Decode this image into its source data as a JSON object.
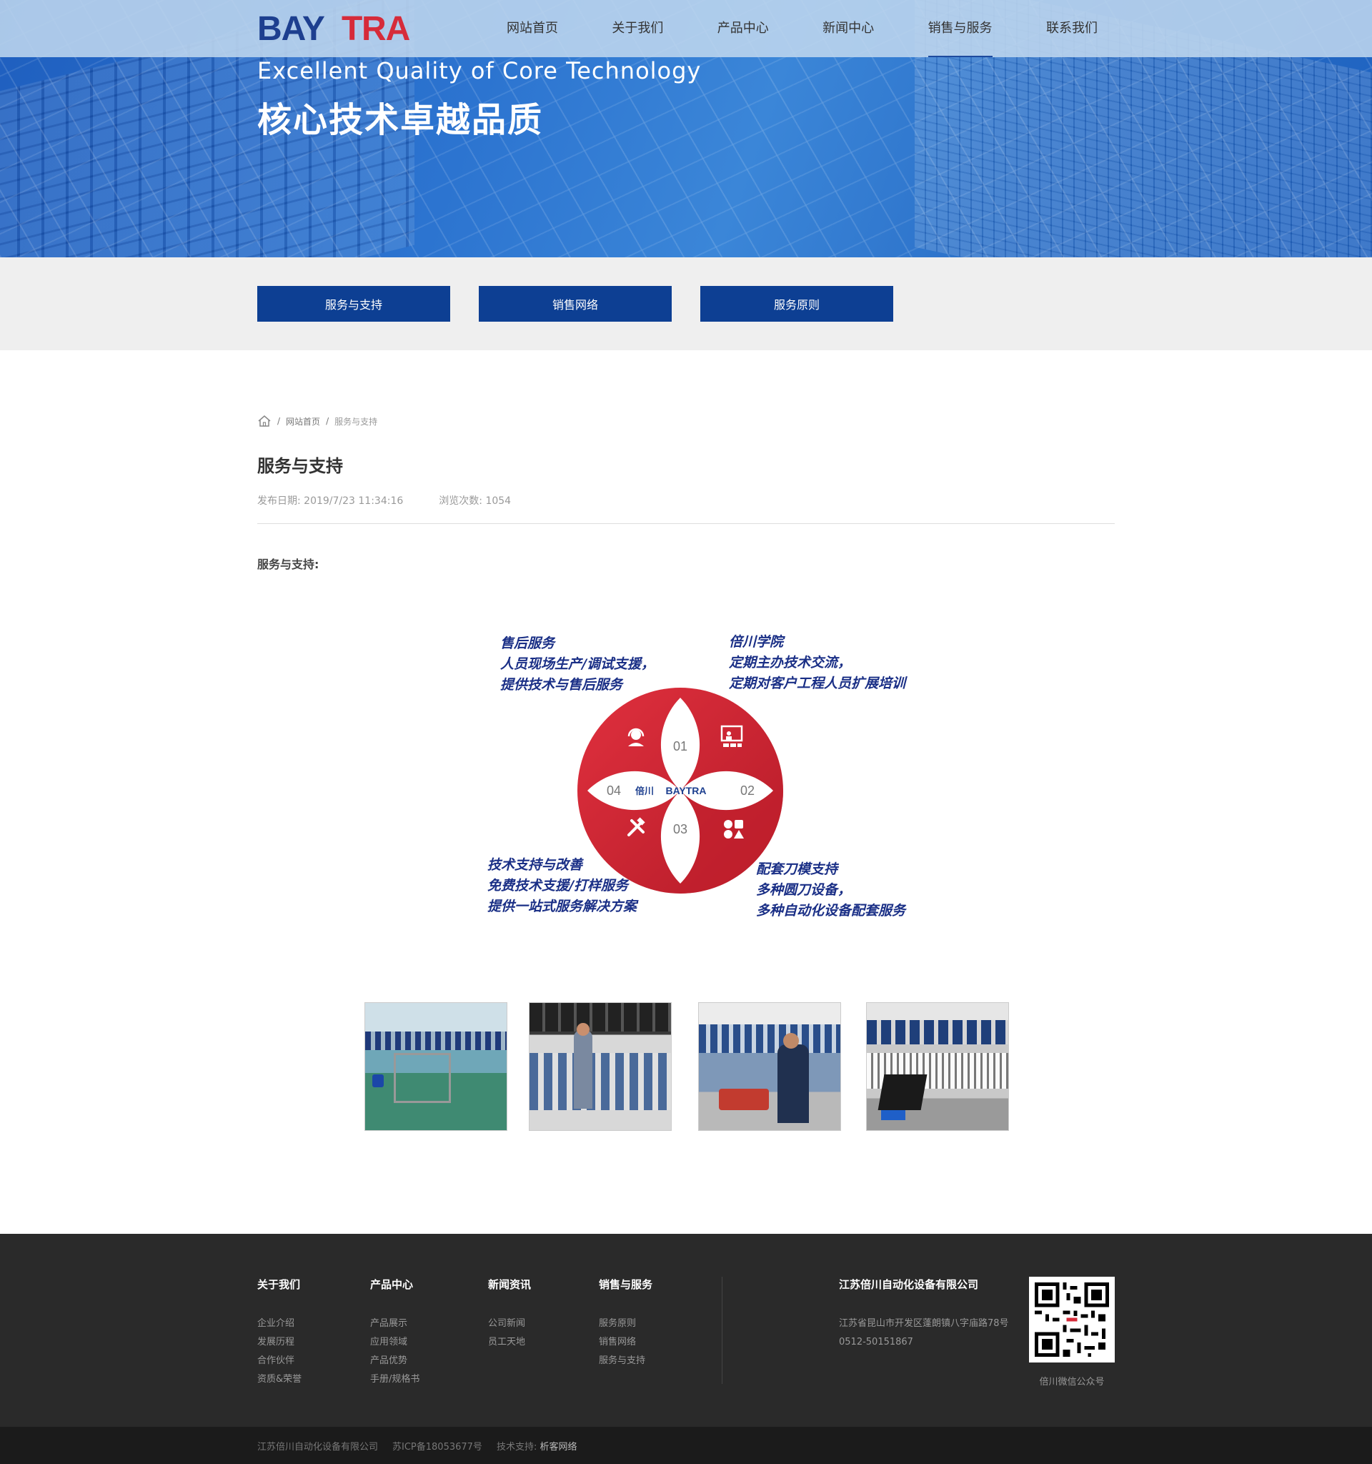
{
  "nav": {
    "brand": "BAYTRA",
    "items": [
      "网站首页",
      "关于我们",
      "产品中心",
      "新闻中心",
      "销售与服务",
      "联系我们"
    ],
    "active_index": 4
  },
  "banner": {
    "slogan_en": "Excellent Quality of Core Technology",
    "slogan_cn": "核心技术卓越品质"
  },
  "subnav": [
    "服务与支持",
    "销售网络",
    "服务原则"
  ],
  "breadcrumb": {
    "home": "网站首页",
    "current": "服务与支持"
  },
  "article": {
    "title": "服务与支持",
    "date_label": "发布日期: 2019/7/23 11:34:16",
    "views_label": "浏览次数: 1054",
    "lead": "服务与支持:"
  },
  "diagram": {
    "numbers": [
      "01",
      "02",
      "03",
      "04"
    ],
    "center_brand_cn": "倍川",
    "center_brand": "BAYTRA",
    "captions": {
      "top_left": [
        "售后服务",
        "人员现场生产/调试支援，",
        "提供技术与售后服务"
      ],
      "top_right": [
        "倍川学院",
        "定期主办技术交流，",
        "定期对客户工程人员扩展培训"
      ],
      "bottom_left": [
        "技术支持与改善",
        "免费技术支援/打样服务",
        "提供一站式服务解决方案"
      ],
      "bottom_right": [
        "配套刀模支持",
        "多种圆刀设备，",
        "多种自动化设备配套服务"
      ]
    },
    "colors": {
      "red": "#d32333",
      "dark_red": "#b51b28",
      "caption": "#1a2f86"
    }
  },
  "footer": {
    "columns": [
      {
        "title": "关于我们",
        "links": [
          "企业介绍",
          "发展历程",
          "合作伙伴",
          "资质&荣誉"
        ]
      },
      {
        "title": "产品中心",
        "links": [
          "产品展示",
          "应用领域",
          "产品优势",
          "手册/规格书"
        ]
      },
      {
        "title": "新闻资讯",
        "links": [
          "公司新闻",
          "员工天地"
        ]
      },
      {
        "title": "销售与服务",
        "links": [
          "服务原则",
          "销售网络",
          "服务与支持"
        ]
      }
    ],
    "company": "江苏倍川自动化设备有限公司",
    "address": "江苏省昆山市开发区蓬朗镇八字庙路78号",
    "phone": "0512-50151867",
    "qr_caption": "倍川微信公众号",
    "copyright": "江苏倍川自动化设备有限公司",
    "icp": "苏ICP备18053677号",
    "tech_label": "技术支持:",
    "tech_vendor": "析客网络"
  },
  "colors": {
    "brand_blue": "#0d3f93",
    "logo_red": "#d62b3a",
    "footer_bg": "#2a2a2a"
  }
}
